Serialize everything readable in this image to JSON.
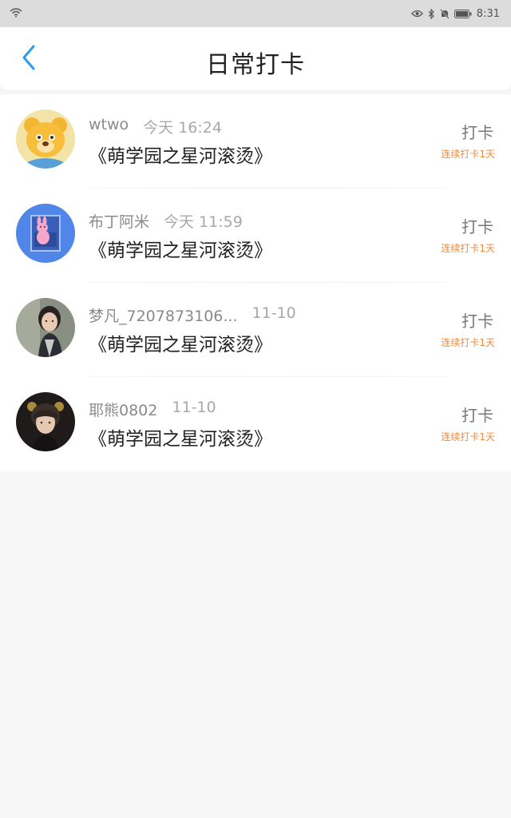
{
  "status_bar": {
    "time": "8:31"
  },
  "header": {
    "title": "日常打卡"
  },
  "records": [
    {
      "username": "wtwo",
      "time": "今天 16:24",
      "book": "《萌学园之星河滚烫》",
      "action": "打卡",
      "streak": "连续打卡1天",
      "avatar": "bear-avatar"
    },
    {
      "username": "布丁阿米",
      "time": "今天 11:59",
      "book": "《萌学园之星河滚烫》",
      "action": "打卡",
      "streak": "连续打卡1天",
      "avatar": "bunny-avatar"
    },
    {
      "username": "梦凡_7207873106...",
      "time": "11-10",
      "book": "《萌学园之星河滚烫》",
      "action": "打卡",
      "streak": "连续打卡1天",
      "avatar": "girl-avatar"
    },
    {
      "username": "耶熊0802",
      "time": "11-10",
      "book": "《萌学园之星河滚烫》",
      "action": "打卡",
      "streak": "连续打卡1天",
      "avatar": "boy-avatar"
    }
  ],
  "colors": {
    "accent": "#2e9bef",
    "streak": "#f08a3e",
    "background": "#f7f6f6"
  }
}
